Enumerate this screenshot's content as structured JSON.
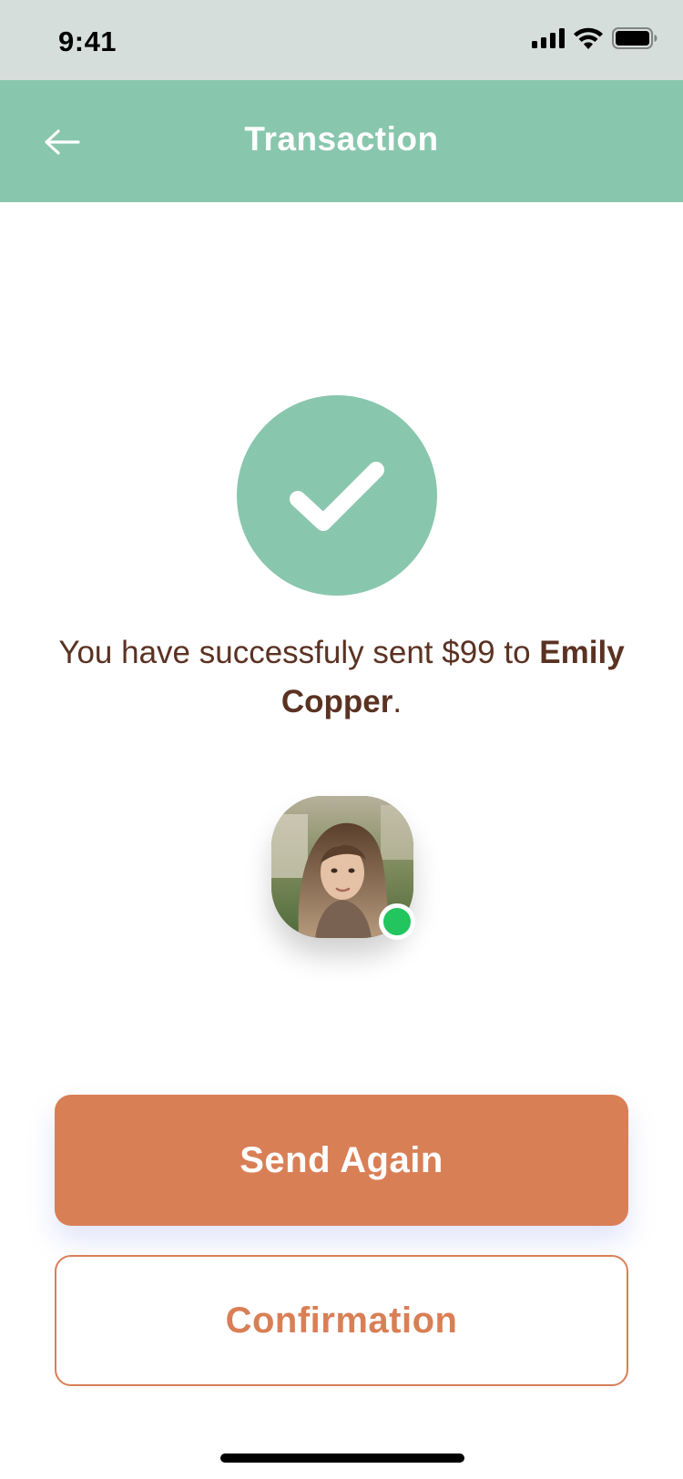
{
  "status_bar": {
    "time": "9:41",
    "icons": [
      "cellular-signal-icon",
      "wifi-icon",
      "battery-icon"
    ]
  },
  "header": {
    "title": "Transaction",
    "back_icon": "back-arrow-icon"
  },
  "success": {
    "icon": "checkmark-icon",
    "message_prefix": "You have successfuly sent $99 to ",
    "recipient_name": "Emily Copper",
    "message_suffix": "."
  },
  "recipient": {
    "avatar_icon": "avatar",
    "status": "online"
  },
  "actions": {
    "send_again_label": "Send Again",
    "confirmation_label": "Confirmation"
  },
  "colors": {
    "accent_green": "#89c6ae",
    "accent_orange": "#d97f56",
    "text_brown": "#5b3222",
    "status_online": "#22c55e",
    "status_bar_bg": "#d5dedb"
  }
}
